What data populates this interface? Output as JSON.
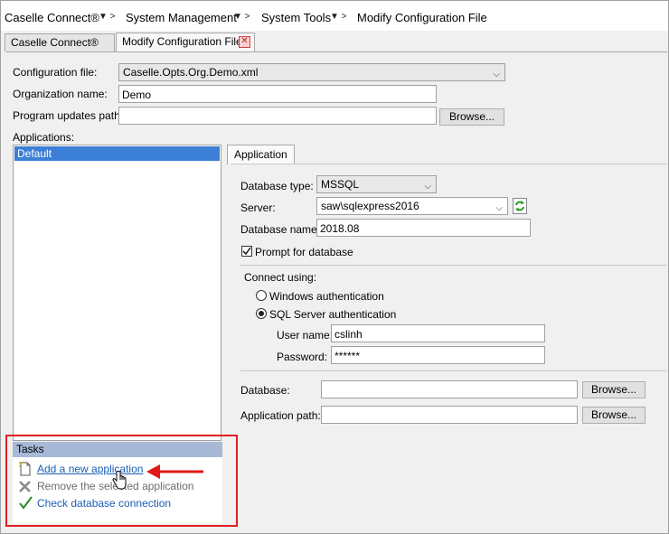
{
  "breadcrumb": {
    "items": [
      "Caselle Connect®",
      "System Management",
      "System Tools",
      "Modify Configuration File"
    ]
  },
  "tabs": {
    "home_label": "Caselle Connect®",
    "active_label": "Modify Configuration File"
  },
  "form": {
    "config_file_label": "Configuration file:",
    "config_file_value": "Caselle.Opts.Org.Demo.xml",
    "org_name_label": "Organization name:",
    "org_name_value": "Demo",
    "updates_path_label": "Program updates path:",
    "updates_path_value": "",
    "browse_label": "Browse...",
    "applications_label": "Applications:"
  },
  "applications": {
    "items": [
      "Default"
    ]
  },
  "tasks": {
    "header": "Tasks",
    "add": "Add a new application",
    "remove": "Remove the selected application",
    "check": "Check database connection"
  },
  "app_panel": {
    "tab_label": "Application",
    "db_type_label": "Database type:",
    "db_type_value": "MSSQL",
    "server_label": "Server:",
    "server_value": "saw\\sqlexpress2016",
    "db_name_label": "Database name:",
    "db_name_value": "2018.08",
    "prompt_label": "Prompt for database",
    "prompt_checked": true,
    "connect_label": "Connect using:",
    "windows_auth_label": "Windows authentication",
    "sql_auth_label": "SQL Server authentication",
    "selected_auth": "sql",
    "username_label": "User name:",
    "username_value": "cslinh",
    "password_label": "Password:",
    "password_value": "******",
    "database_label": "Database:",
    "database_value": "",
    "app_path_label": "Application path:",
    "app_path_value": "",
    "browse_label": "Browse..."
  },
  "colors": {
    "selection": "#3c7fd6",
    "tasks_header": "#a7b9d7",
    "link": "#1a5fb4",
    "highlight_box": "#e02020"
  }
}
